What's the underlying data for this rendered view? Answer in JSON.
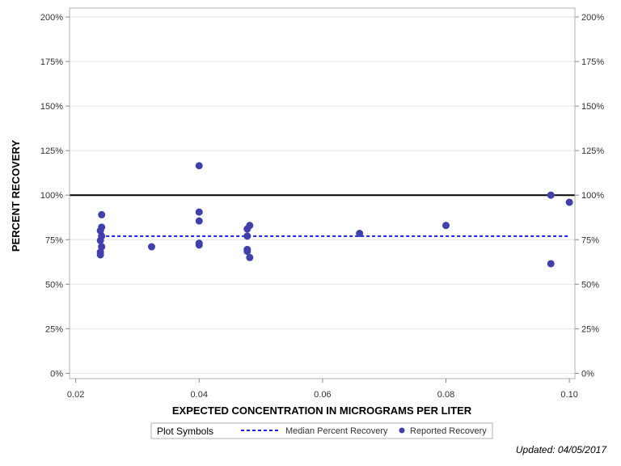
{
  "chart_data": {
    "type": "scatter",
    "xlabel": "EXPECTED CONCENTRATION IN MICROGRAMS PER LITER",
    "ylabel": "PERCENT RECOVERY",
    "xlim": [
      0.019,
      0.1009
    ],
    "ylim": [
      -3,
      205
    ],
    "x_ticks": [
      0.02,
      0.04,
      0.06,
      0.08,
      0.1
    ],
    "x_tick_labels": [
      "0.02",
      "0.04",
      "0.06",
      "0.08",
      "0.10"
    ],
    "y_ticks": [
      0,
      25,
      50,
      75,
      100,
      125,
      150,
      175,
      200
    ],
    "y_tick_labels": [
      "0%",
      "25%",
      "50%",
      "75%",
      "100%",
      "125%",
      "150%",
      "175%",
      "200%"
    ],
    "reference_line": {
      "y": 100,
      "color": "#000000"
    },
    "median_line": {
      "name": "Median Percent Recovery",
      "y": 77,
      "x_range": [
        0.024,
        0.1
      ],
      "color": "#1a1aff"
    },
    "series": [
      {
        "name": "Reported Recovery",
        "color": "#3f3fb0",
        "points": [
          [
            0.0242,
            89
          ],
          [
            0.0242,
            82
          ],
          [
            0.024,
            80
          ],
          [
            0.0242,
            77
          ],
          [
            0.024,
            74.5
          ],
          [
            0.0242,
            71
          ],
          [
            0.024,
            68
          ],
          [
            0.024,
            66.5
          ],
          [
            0.0323,
            71
          ],
          [
            0.04,
            116.5
          ],
          [
            0.04,
            90.5
          ],
          [
            0.04,
            85.5
          ],
          [
            0.04,
            73
          ],
          [
            0.04,
            72
          ],
          [
            0.0478,
            81
          ],
          [
            0.0482,
            83
          ],
          [
            0.0478,
            77
          ],
          [
            0.0478,
            69.5
          ],
          [
            0.0478,
            68.5
          ],
          [
            0.0482,
            65
          ],
          [
            0.066,
            78.5
          ],
          [
            0.08,
            83
          ],
          [
            0.097,
            100
          ],
          [
            0.097,
            61.5
          ],
          [
            0.1,
            96
          ]
        ]
      }
    ],
    "grid": true
  },
  "legend": {
    "title": "Plot Symbols",
    "items": [
      {
        "label": "Median Percent Recovery",
        "kind": "dashed-line"
      },
      {
        "label": "Reported Recovery",
        "kind": "marker"
      }
    ]
  },
  "footer": {
    "updated": "Updated: 04/05/2017"
  }
}
